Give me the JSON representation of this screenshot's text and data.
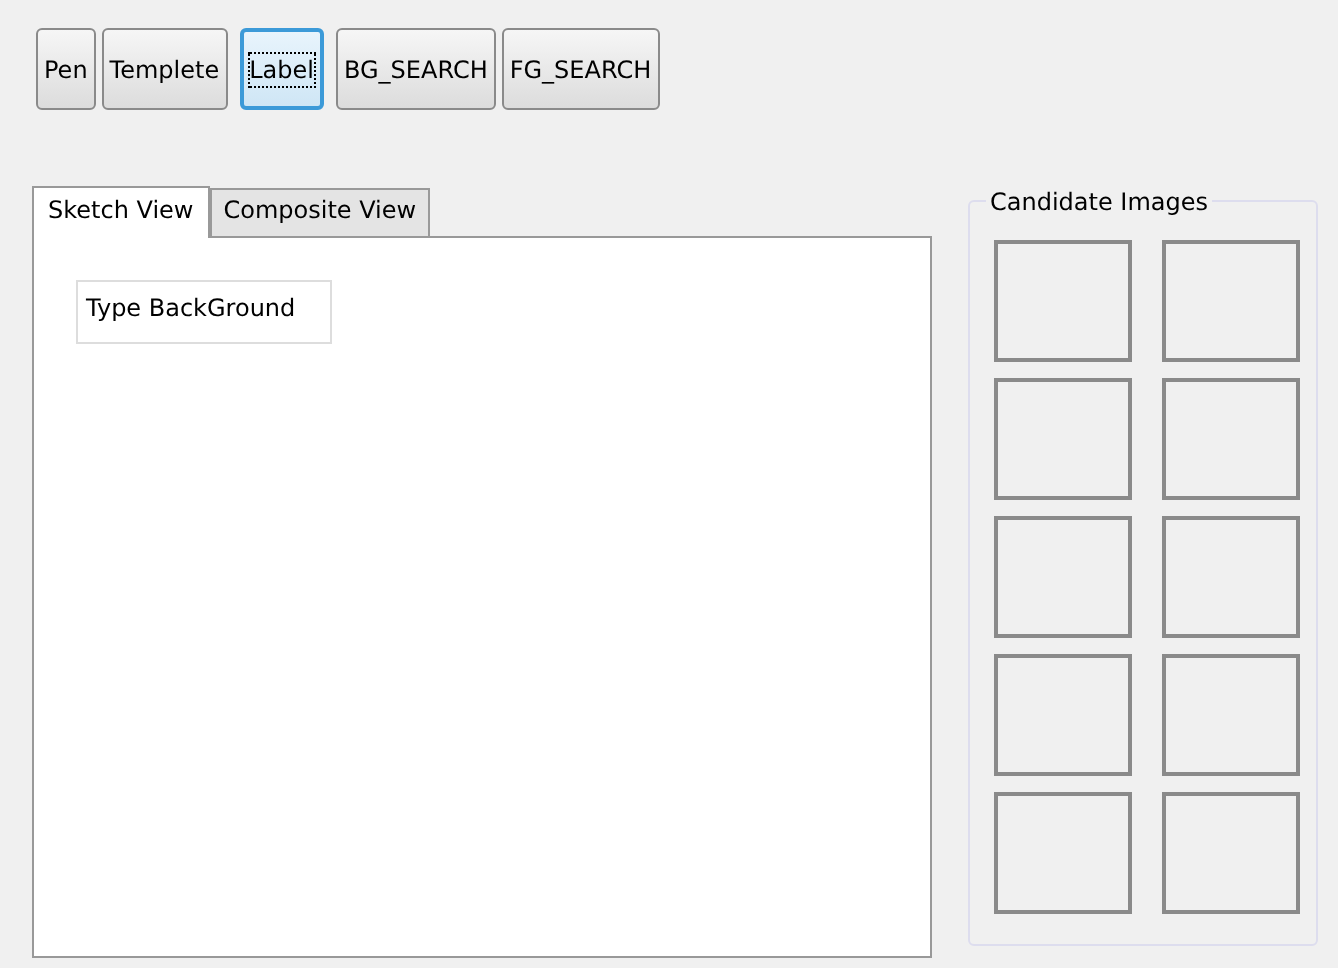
{
  "toolbar": [
    {
      "label": "Pen",
      "focused": false
    },
    {
      "label": "Templete",
      "focused": false
    },
    {
      "label": "Label",
      "focused": true
    },
    {
      "label": "BG_SEARCH",
      "focused": false
    },
    {
      "label": "FG_SEARCH",
      "focused": false
    }
  ],
  "tabs": [
    {
      "label": "Sketch View",
      "selected": true
    },
    {
      "label": "Composite View",
      "selected": false
    }
  ],
  "canvas": {
    "labels": [
      {
        "text": "Type BackGround"
      }
    ]
  },
  "candidate_images": {
    "title": "Candidate Images",
    "slots": [
      {
        "kind": "empty"
      },
      {
        "kind": "empty"
      },
      {
        "kind": "empty"
      },
      {
        "kind": "empty"
      },
      {
        "kind": "empty"
      },
      {
        "kind": "empty"
      },
      {
        "kind": "empty"
      },
      {
        "kind": "empty"
      },
      {
        "kind": "empty"
      },
      {
        "kind": "empty"
      }
    ]
  }
}
